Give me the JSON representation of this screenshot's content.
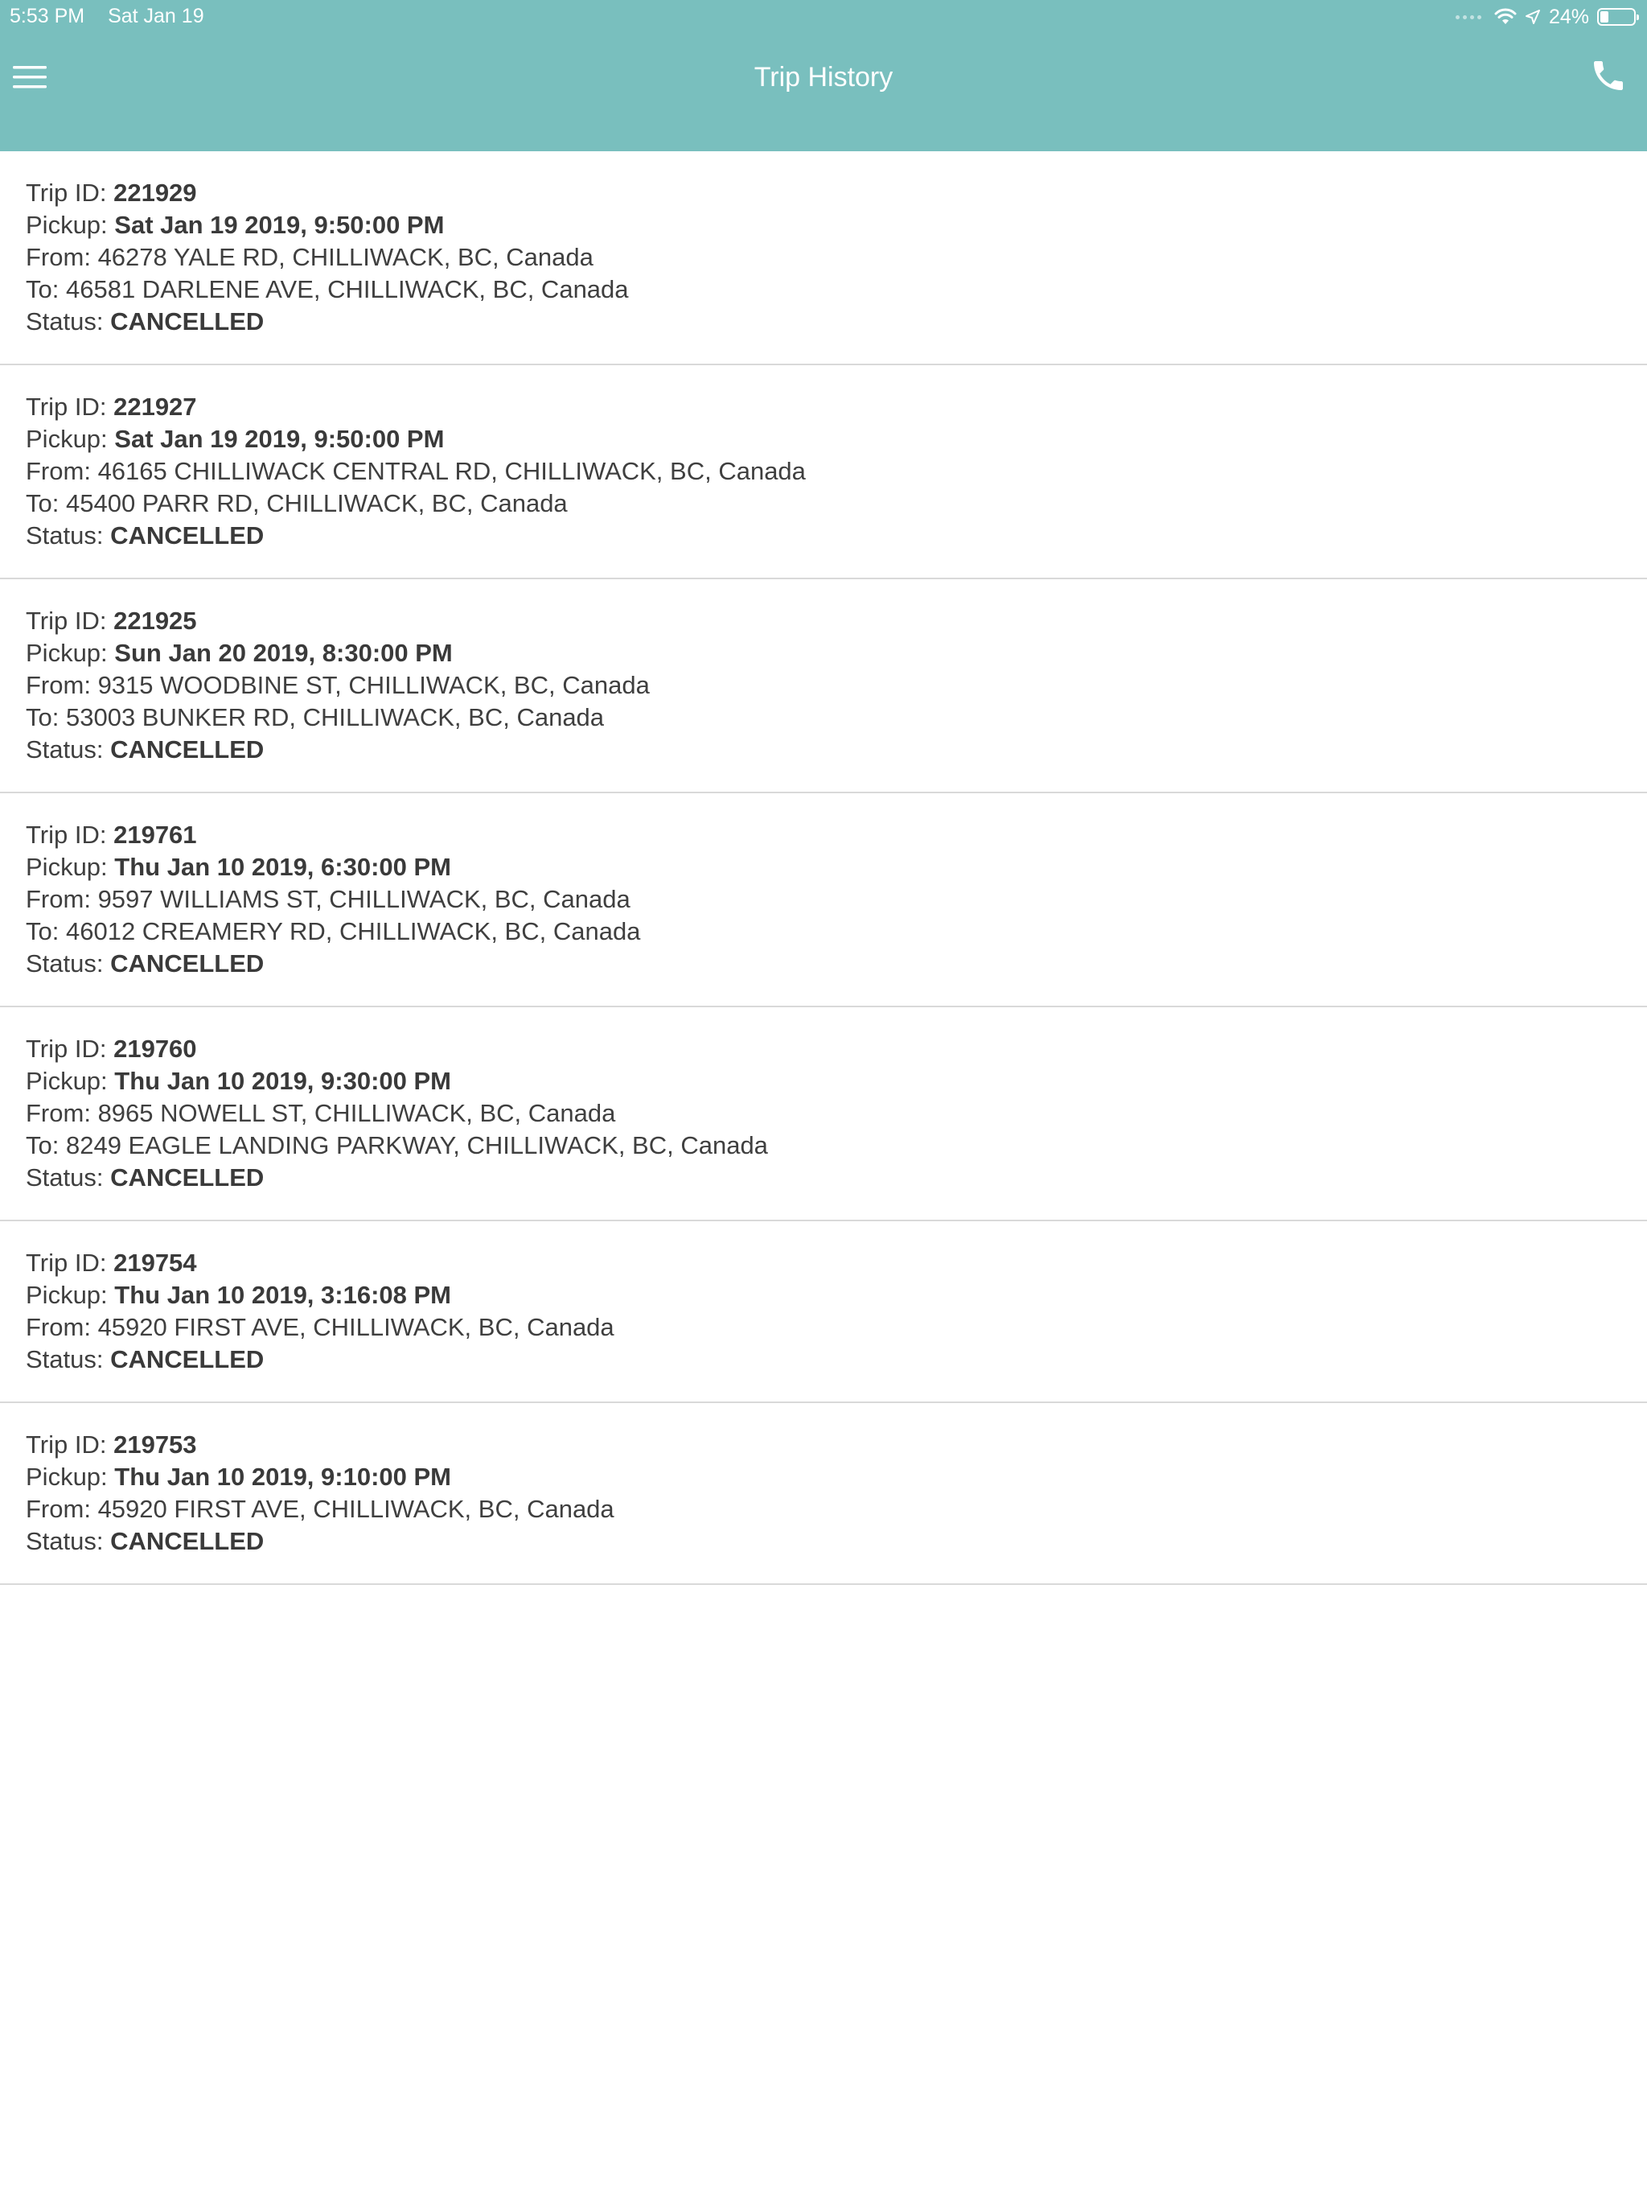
{
  "status_bar": {
    "time": "5:53 PM",
    "date": "Sat Jan 19",
    "battery_percent": "24%",
    "battery_level": 0.24
  },
  "nav": {
    "title": "Trip History",
    "menu_icon": "hamburger-menu-icon",
    "call_icon": "phone-icon"
  },
  "labels": {
    "trip_id": "Trip ID:",
    "pickup": "Pickup:",
    "from": "From:",
    "to": "To:",
    "status": "Status:"
  },
  "colors": {
    "header": "#79bfbe",
    "divider": "#d9d9d9"
  },
  "trips": [
    {
      "id": "221929",
      "pickup": "Sat Jan 19 2019, 9:50:00 PM",
      "from": "46278 YALE RD, CHILLIWACK, BC, Canada",
      "to": "46581 DARLENE AVE, CHILLIWACK, BC, Canada",
      "status": "CANCELLED"
    },
    {
      "id": "221927",
      "pickup": "Sat Jan 19 2019, 9:50:00 PM",
      "from": "46165 CHILLIWACK CENTRAL RD, CHILLIWACK, BC, Canada",
      "to": "45400 PARR RD, CHILLIWACK, BC, Canada",
      "status": "CANCELLED"
    },
    {
      "id": "221925",
      "pickup": "Sun Jan 20 2019, 8:30:00 PM",
      "from": "9315 WOODBINE ST, CHILLIWACK, BC, Canada",
      "to": "53003 BUNKER RD, CHILLIWACK, BC, Canada",
      "status": "CANCELLED"
    },
    {
      "id": "219761",
      "pickup": "Thu Jan 10 2019, 6:30:00 PM",
      "from": "9597 WILLIAMS ST, CHILLIWACK, BC, Canada",
      "to": "46012 CREAMERY RD, CHILLIWACK, BC, Canada",
      "status": "CANCELLED"
    },
    {
      "id": "219760",
      "pickup": "Thu Jan 10 2019, 9:30:00 PM",
      "from": "8965 NOWELL ST, CHILLIWACK, BC, Canada",
      "to": "8249 EAGLE LANDING PARKWAY, CHILLIWACK, BC, Canada",
      "status": "CANCELLED"
    },
    {
      "id": "219754",
      "pickup": "Thu Jan 10 2019, 3:16:08 PM",
      "from": "45920 FIRST AVE, CHILLIWACK, BC, Canada",
      "status": "CANCELLED"
    },
    {
      "id": "219753",
      "pickup": "Thu Jan 10 2019, 9:10:00 PM",
      "from": "45920 FIRST AVE, CHILLIWACK, BC, Canada",
      "status": "CANCELLED"
    }
  ]
}
